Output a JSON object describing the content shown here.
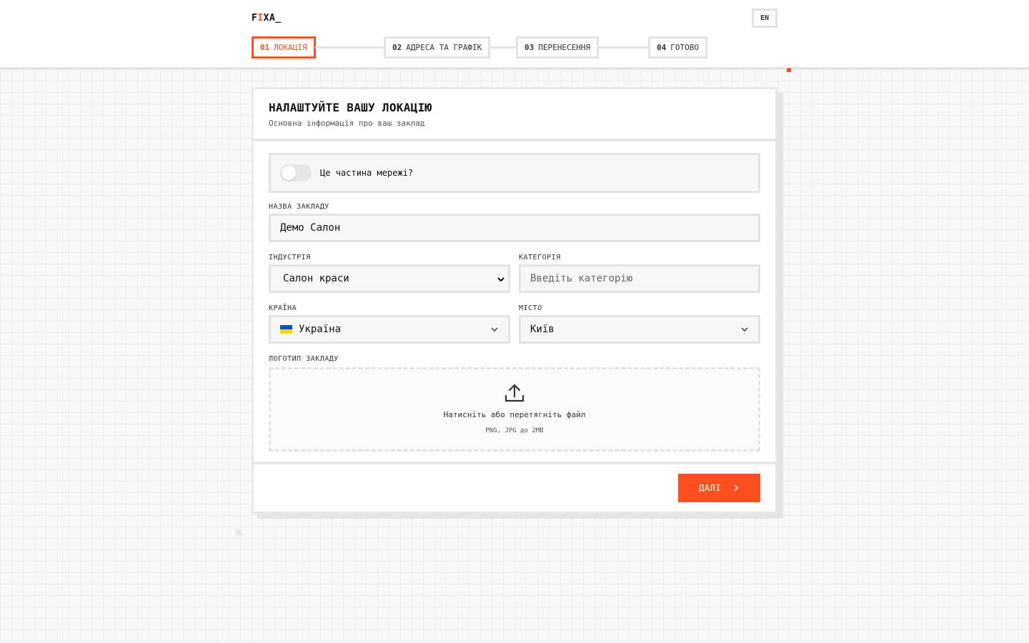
{
  "app": {
    "logo_prefix": "F",
    "logo_accent": "I",
    "logo_suffix": "XA_",
    "language": "EN",
    "accent_color": "#ff4f1f"
  },
  "steps": [
    {
      "num": "01",
      "label": "ЛОКАЦІЯ",
      "active": true
    },
    {
      "num": "02",
      "label": "АДРЕСА ТА ГРАФІК",
      "active": false
    },
    {
      "num": "03",
      "label": "ПЕРЕНЕСЕННЯ",
      "active": false
    },
    {
      "num": "04",
      "label": "ГОТОВО",
      "active": false
    }
  ],
  "card": {
    "title": "НАЛАШТУЙТЕ ВАШУ ЛОКАЦІЮ",
    "subtitle": "Основна інформація про ваш заклад"
  },
  "form": {
    "network_toggle_label": "Це частина мережі?",
    "network_toggle_on": false,
    "name_label": "НАЗВА ЗАКЛАДУ",
    "name_value": "Демо Салон",
    "industry_label": "ІНДУСТРІЯ",
    "industry_value": "Салон краси",
    "category_label": "КАТЕГОРІЯ",
    "category_placeholder": "Введіть категорію",
    "country_label": "КРАЇНА",
    "country_value": "Україна",
    "country_flag_icon": "ukraine-flag-icon",
    "city_label": "МІСТО",
    "city_value": "Київ",
    "logo_label": "ЛОГОТИП ЗАКЛАДУ",
    "upload_icon": "upload-icon",
    "upload_text": "Натисніть або перетягніть файл",
    "upload_hint": "PNG, JPG до 2MB"
  },
  "footer": {
    "next_label": "ДАЛІ",
    "next_icon": "chevron-right-icon"
  }
}
